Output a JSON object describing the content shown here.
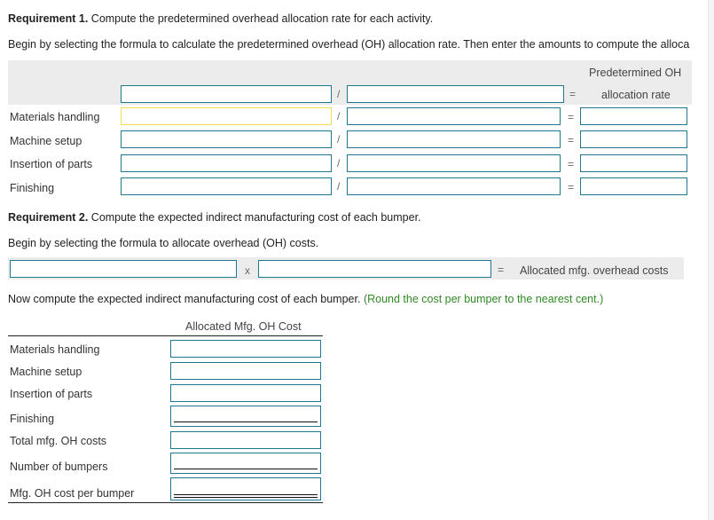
{
  "req1": {
    "heading_bold": "Requirement 1.",
    "heading_text": " Compute the predetermined overhead allocation rate for each activity.",
    "instruction": "Begin by selecting the formula to calculate the predetermined overhead (OH) allocation rate. Then enter the amounts to compute the alloca",
    "result_header_line1": "Predetermined OH",
    "result_header_line2": "allocation rate",
    "divide_symbol": "/",
    "equals_symbol": "=",
    "rows": [
      {
        "label": "Materials handling"
      },
      {
        "label": "Machine setup"
      },
      {
        "label": "Insertion of parts"
      },
      {
        "label": "Finishing"
      }
    ]
  },
  "req2": {
    "heading_bold": "Requirement 2.",
    "heading_text": " Compute the expected indirect manufacturing cost of each bumper.",
    "instruction": "Begin by selecting the formula to allocate overhead (OH) costs.",
    "multiply_symbol": "x",
    "equals_symbol": "=",
    "formula_result_label": "Allocated mfg. overhead costs",
    "compute_instruction": "Now compute the expected indirect manufacturing cost of each bumper.",
    "compute_hint": "(Round the cost per bumper to the nearest cent.)",
    "column_header": "Allocated Mfg. OH Cost",
    "rows": [
      {
        "label": "Materials handling"
      },
      {
        "label": "Machine setup"
      },
      {
        "label": "Insertion of parts"
      },
      {
        "label": "Finishing"
      },
      {
        "label": "Total mfg. OH costs"
      },
      {
        "label": "Number of bumpers"
      },
      {
        "label": "Mfg. OH cost per bumper"
      }
    ]
  },
  "colors": {
    "input_border": "#1d7a8c",
    "focused_input_border": "#f5dc5a",
    "hint_green": "#2e8b22",
    "header_band": "#ececec"
  }
}
